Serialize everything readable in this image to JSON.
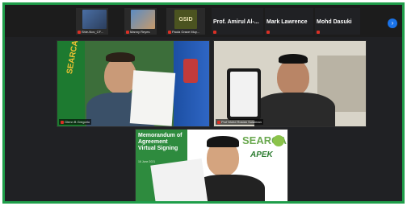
{
  "participants_strip": {
    "thumbnails": [
      {
        "name": "Shie-Nov_CF..."
      },
      {
        "name": "Manny Reyes"
      },
      {
        "name": "Paula Grace Muy..."
      }
    ],
    "name_only": [
      {
        "name": "Prof. Amirul Al-..."
      },
      {
        "name": "Mark Lawrence"
      },
      {
        "name": "Mohd Dasuki"
      }
    ],
    "next_arrow": "›"
  },
  "gallery": {
    "tiles": [
      {
        "name": "Glenn B Gregorio"
      },
      {
        "name": "Prof Mohd Roslan Sulaiman"
      },
      {
        "name": ""
      }
    ]
  },
  "slide": {
    "title": "Memorandum of Agreement Virtual Signing",
    "date": "16 June 2021",
    "logo_text": "SEARCA",
    "partner_text": "APEK"
  },
  "thumb_logo_text": "GSID",
  "flag_text": "SEARCA",
  "colors": {
    "frame": "#1f9e4a",
    "background": "#202124",
    "mic": "#d93025",
    "arrow": "#1a73e8"
  }
}
